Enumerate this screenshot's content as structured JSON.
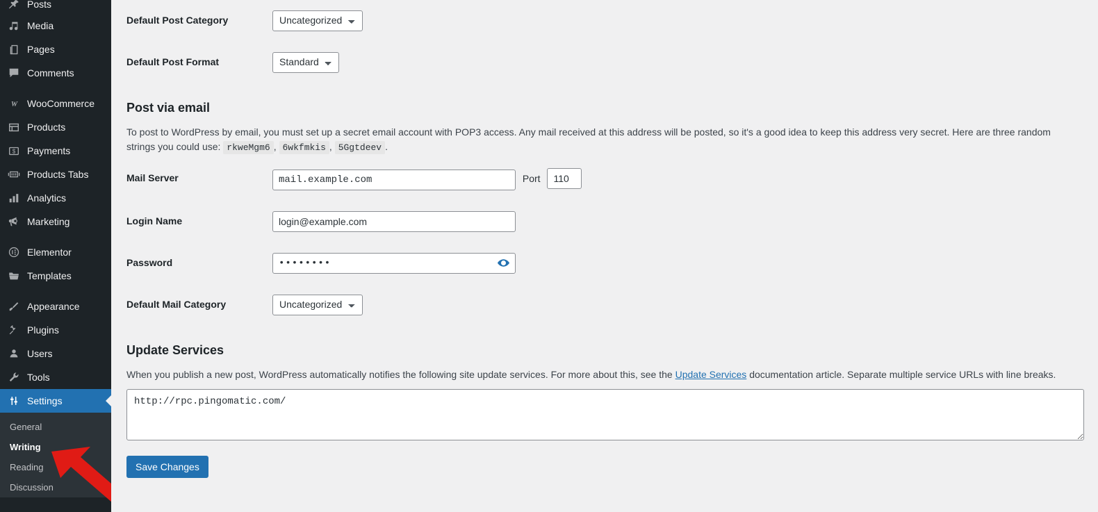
{
  "sidebar": {
    "items": [
      {
        "label": "Posts",
        "icon": "pin-icon",
        "name": "posts"
      },
      {
        "label": "Media",
        "icon": "media-icon",
        "name": "media"
      },
      {
        "label": "Pages",
        "icon": "pages-icon",
        "name": "pages"
      },
      {
        "label": "Comments",
        "icon": "comments-icon",
        "name": "comments"
      },
      {
        "separator": true
      },
      {
        "label": "WooCommerce",
        "icon": "woocommerce-icon",
        "name": "woocommerce"
      },
      {
        "label": "Products",
        "icon": "products-icon",
        "name": "products"
      },
      {
        "label": "Payments",
        "icon": "payments-icon",
        "name": "payments"
      },
      {
        "label": "Products Tabs",
        "icon": "products-tabs-icon",
        "name": "products-tabs"
      },
      {
        "label": "Analytics",
        "icon": "analytics-icon",
        "name": "analytics"
      },
      {
        "label": "Marketing",
        "icon": "marketing-icon",
        "name": "marketing"
      },
      {
        "separator": true
      },
      {
        "label": "Elementor",
        "icon": "elementor-icon",
        "name": "elementor"
      },
      {
        "label": "Templates",
        "icon": "templates-icon",
        "name": "templates"
      },
      {
        "separator": true
      },
      {
        "label": "Appearance",
        "icon": "appearance-icon",
        "name": "appearance"
      },
      {
        "label": "Plugins",
        "icon": "plugins-icon",
        "name": "plugins"
      },
      {
        "label": "Users",
        "icon": "users-icon",
        "name": "users"
      },
      {
        "label": "Tools",
        "icon": "tools-icon",
        "name": "tools"
      },
      {
        "label": "Settings",
        "icon": "settings-icon",
        "name": "settings",
        "active": true
      }
    ],
    "submenu": [
      {
        "label": "General",
        "current": false
      },
      {
        "label": "Writing",
        "current": true
      },
      {
        "label": "Reading",
        "current": false
      },
      {
        "label": "Discussion",
        "current": false
      }
    ],
    "colors": {
      "background": "#1d2327",
      "submenu_background": "#2c3338",
      "active_background": "#2271b1",
      "text": "#f0f0f1"
    }
  },
  "annotation": {
    "arrow_color": "#e01b15",
    "points_to": "Writing"
  },
  "form": {
    "default_post_category": {
      "label": "Default Post Category",
      "value": "Uncategorized"
    },
    "default_post_format": {
      "label": "Default Post Format",
      "value": "Standard"
    },
    "mail_server": {
      "label": "Mail Server",
      "value": "mail.example.com",
      "port_label": "Port",
      "port_value": "110"
    },
    "login_name": {
      "label": "Login Name",
      "value": "login@example.com"
    },
    "password": {
      "label": "Password",
      "value": "••••••••",
      "toggle_icon": "eye-icon"
    },
    "default_mail_category": {
      "label": "Default Mail Category",
      "value": "Uncategorized"
    }
  },
  "post_via_email": {
    "heading": "Post via email",
    "description_before": "To post to WordPress by email, you must set up a secret email account with POP3 access. Any mail received at this address will be posted, so it's a good idea to keep this address very secret. Here are three random strings you could use:",
    "random_strings": [
      "rkweMgm6",
      "6wkfmkis",
      "5Ggtdeev"
    ],
    "description_after": "."
  },
  "update_services": {
    "heading": "Update Services",
    "description_before": "When you publish a new post, WordPress automatically notifies the following site update services. For more about this, see the ",
    "link_text": "Update Services",
    "description_after": " documentation article. Separate multiple service URLs with line breaks.",
    "textarea_value": "http://rpc.pingomatic.com/"
  },
  "submit": {
    "save_label": "Save Changes",
    "button_color": "#2271b1"
  }
}
